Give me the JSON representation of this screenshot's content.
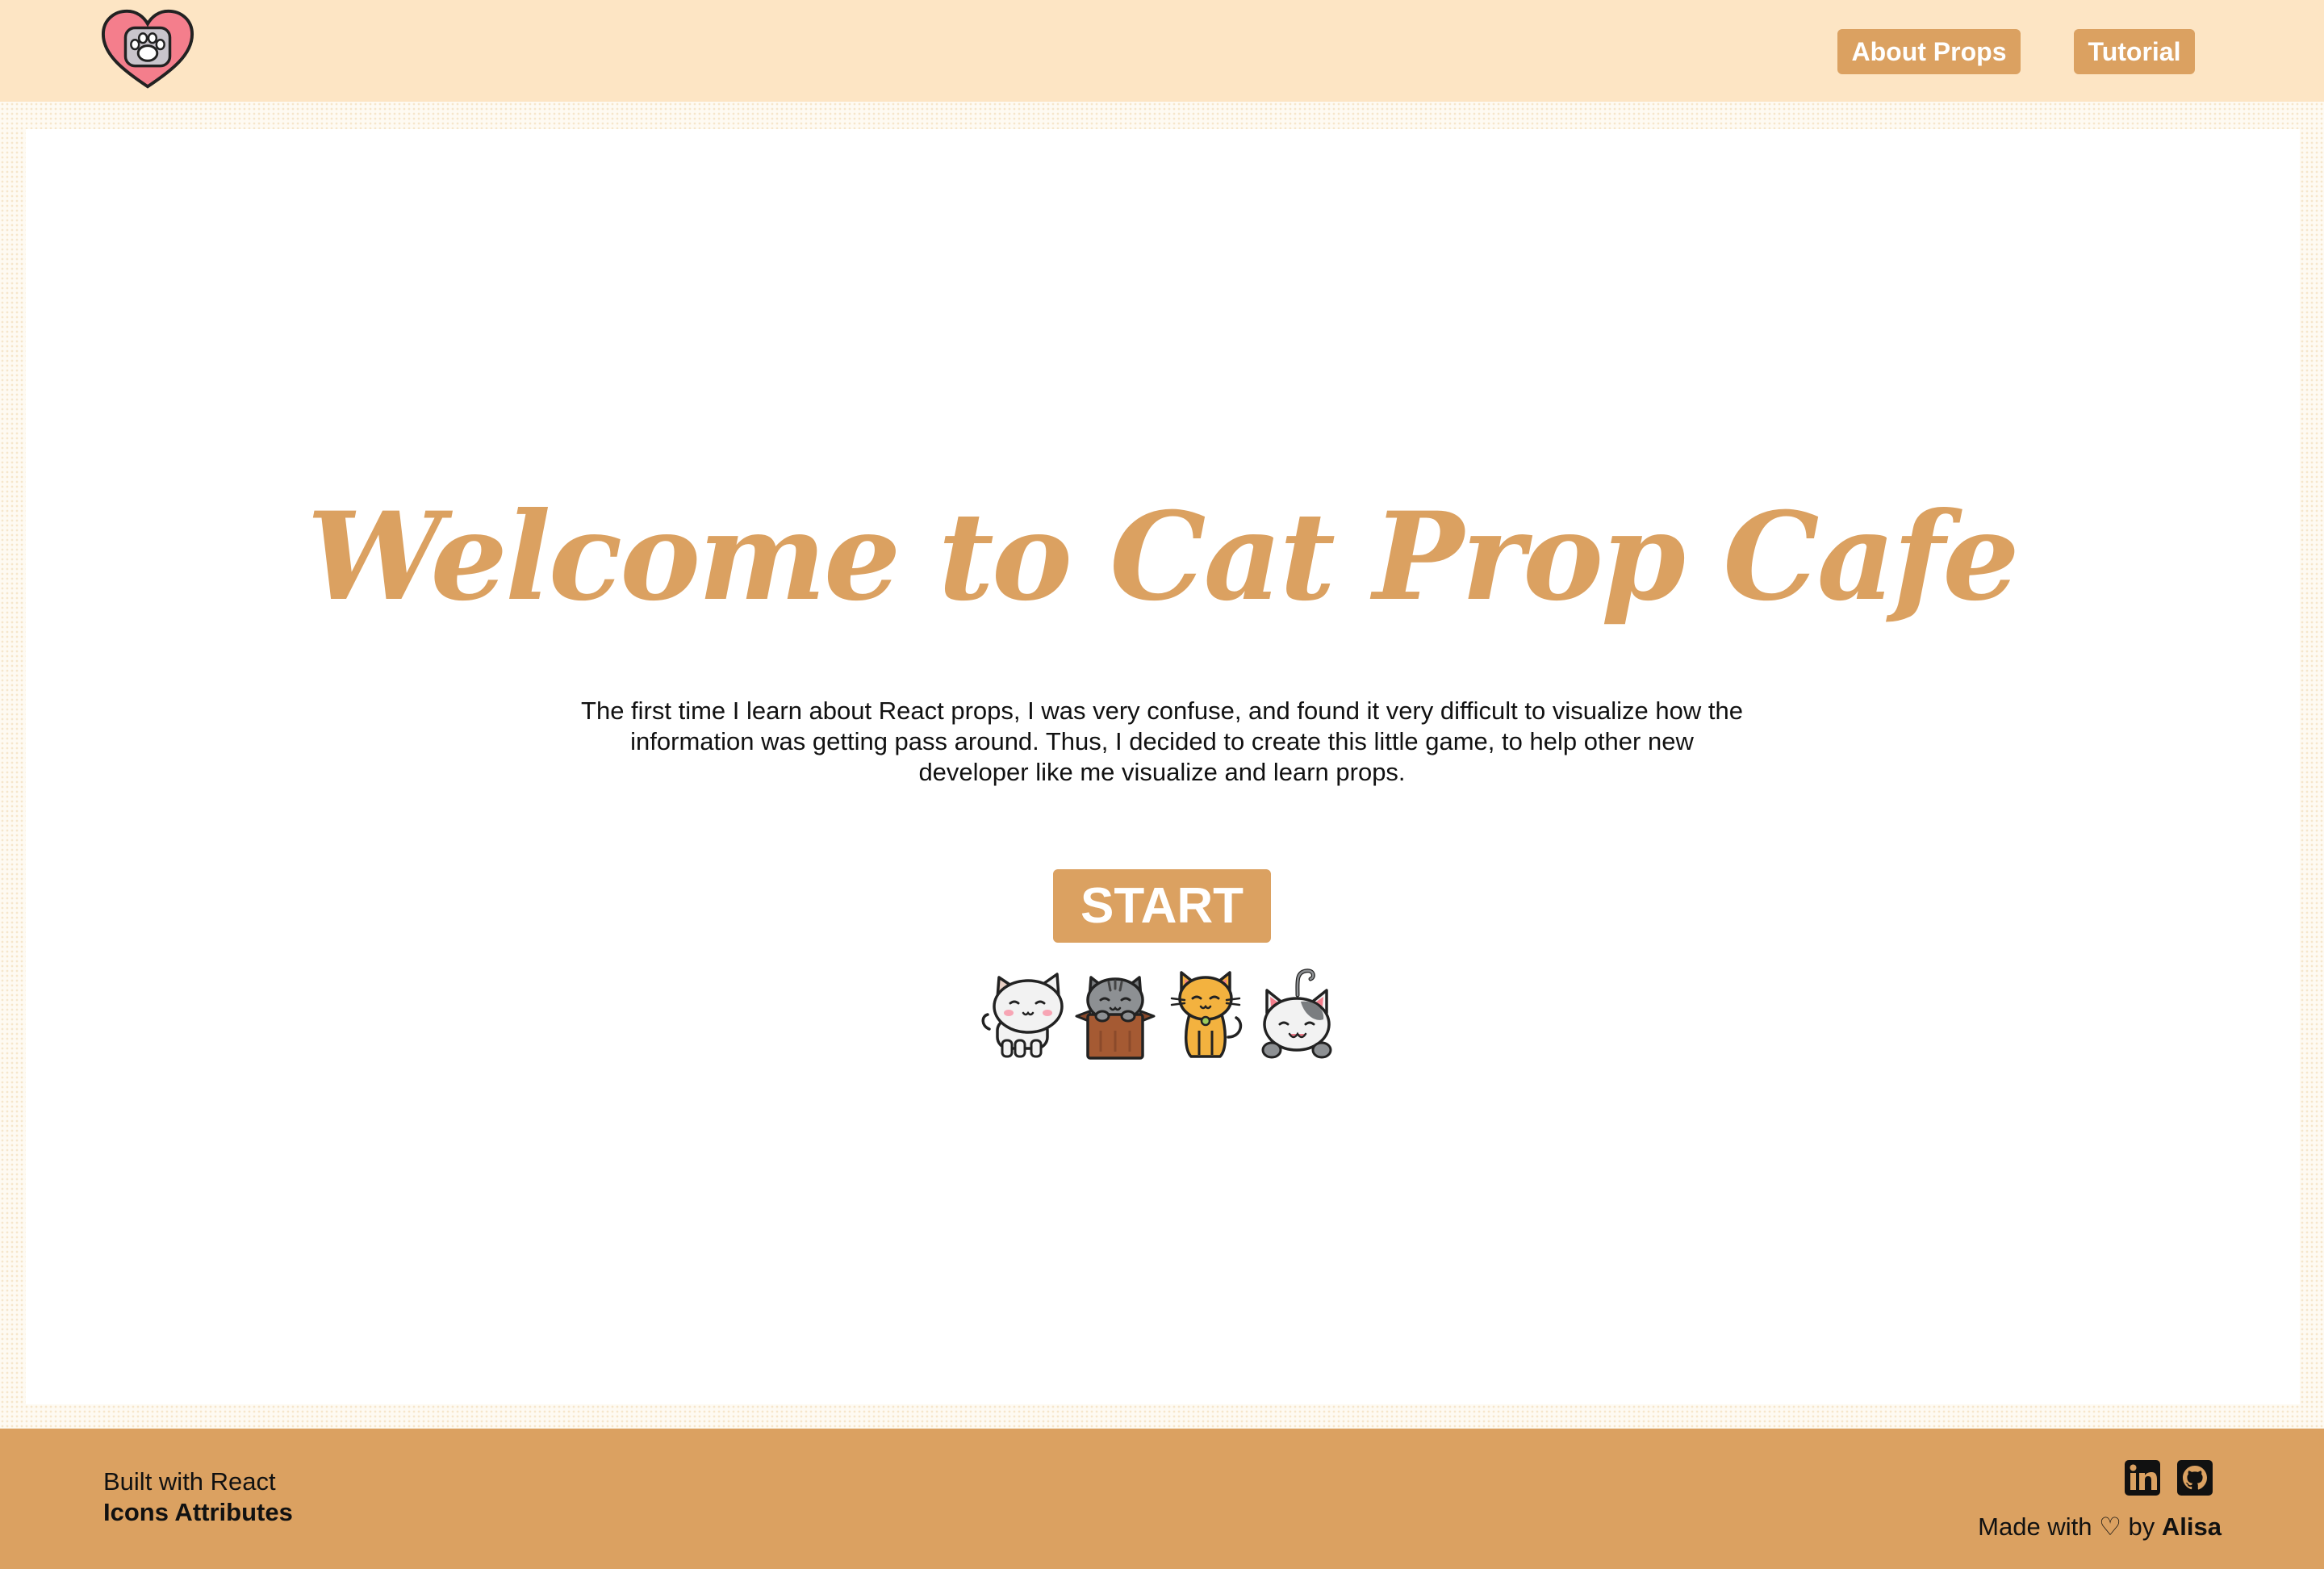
{
  "header": {
    "logo_icon": "heart-paw-icon",
    "nav": {
      "about_label": "About Props",
      "tutorial_label": "Tutorial"
    }
  },
  "main": {
    "title": "Welcome to Cat Prop Cafe",
    "intro": "The first time I learn about React props, I was very confuse, and found it very difficult to visualize how the information was getting pass around. Thus, I decided to create this little game, to help other new developer like me visualize and learn props.",
    "start_label": "START",
    "cats": [
      "white-cat-icon",
      "grey-cat-in-box-icon",
      "orange-cat-icon",
      "calico-cat-icon"
    ]
  },
  "footer": {
    "built_with": "Built with React",
    "icons_attributes": "Icons Attributes",
    "social_icons": [
      "linkedin-icon",
      "github-icon"
    ],
    "made_with_prefix": "Made with",
    "heart_glyph": "♡",
    "by": "by",
    "author": "Alisa"
  },
  "colors": {
    "accent": "#dba161",
    "header_bg": "#fde5c4",
    "footer_bg": "#dba161",
    "text": "#111111"
  }
}
